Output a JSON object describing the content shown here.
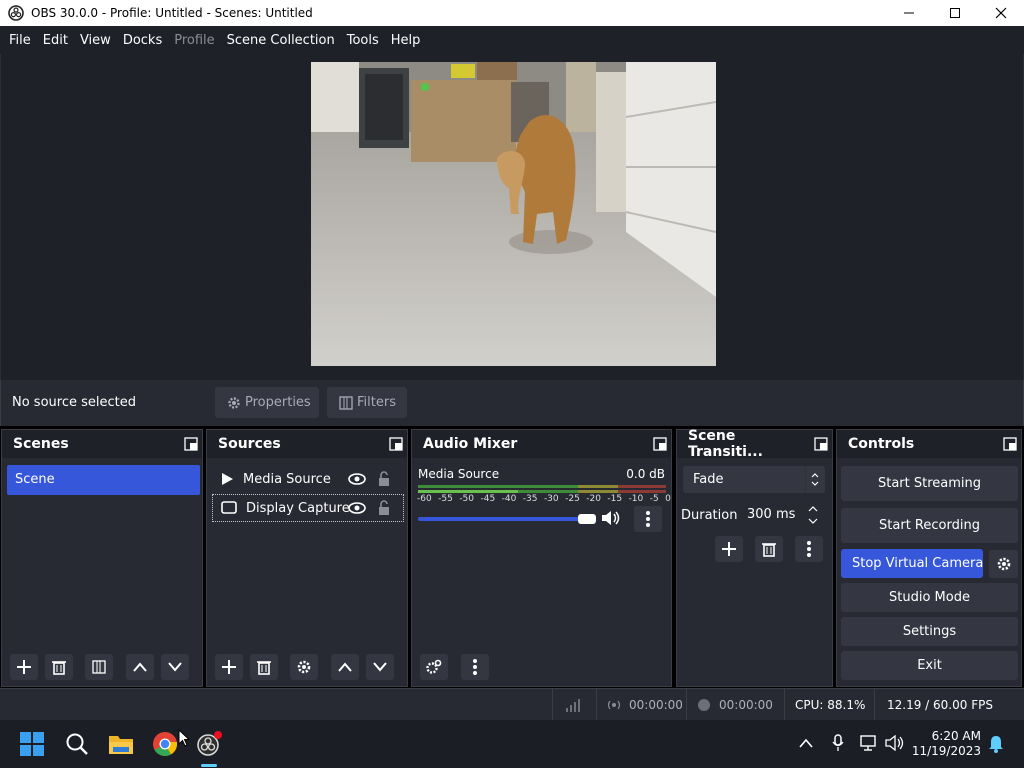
{
  "window": {
    "title": "OBS 30.0.0 - Profile: Untitled - Scenes: Untitled"
  },
  "menu": {
    "items": [
      "File",
      "Edit",
      "View",
      "Docks",
      "Profile",
      "Scene Collection",
      "Tools",
      "Help"
    ]
  },
  "source_bar": {
    "no_source": "No source selected",
    "properties": "Properties",
    "filters": "Filters"
  },
  "scenes": {
    "title": "Scenes",
    "items": [
      "Scene"
    ]
  },
  "sources": {
    "title": "Sources",
    "items": [
      {
        "label": "Media Source"
      },
      {
        "label": "Display Capture"
      }
    ]
  },
  "mixer": {
    "title": "Audio Mixer",
    "channel": "Media Source",
    "db": "0.0 dB",
    "ticks": [
      "-60",
      "-55",
      "-50",
      "-45",
      "-40",
      "-35",
      "-30",
      "-25",
      "-20",
      "-15",
      "-10",
      "-5",
      "0"
    ]
  },
  "transitions": {
    "title": "Scene Transiti...",
    "selected": "Fade",
    "duration_label": "Duration",
    "duration_value": "300 ms"
  },
  "controls": {
    "title": "Controls",
    "start_streaming": "Start Streaming",
    "start_recording": "Start Recording",
    "stop_virtual_camera": "Stop Virtual Camera",
    "studio_mode": "Studio Mode",
    "settings": "Settings",
    "exit": "Exit"
  },
  "status": {
    "stream_time": "00:00:00",
    "record_time": "00:00:00",
    "cpu": "CPU: 88.1%",
    "fps": "12.19 / 60.00 FPS"
  },
  "taskbar": {
    "time": "6:20 AM",
    "date": "11/19/2023"
  },
  "colors": {
    "accent": "#3657d9",
    "panel": "#272a33",
    "header": "#1f2129",
    "button": "#343742"
  }
}
